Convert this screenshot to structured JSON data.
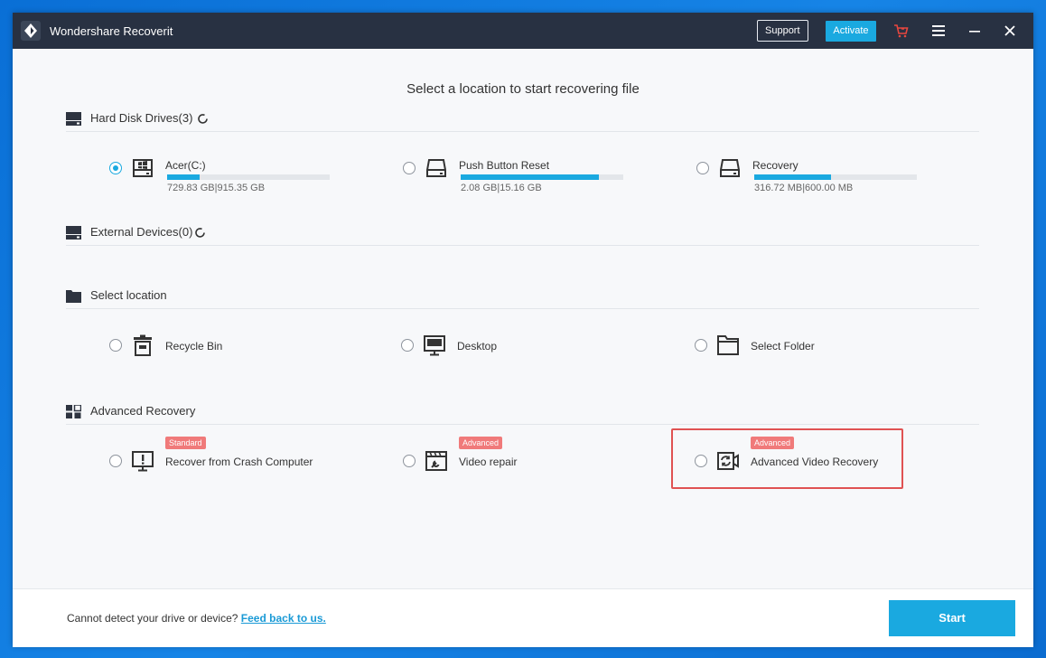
{
  "window": {
    "title": "Wondershare Recoverit",
    "support_label": "Support",
    "activate_label": "Activate"
  },
  "main": {
    "heading": "Select a location to start recovering file"
  },
  "sections": {
    "hard_disk": {
      "label": "Hard Disk Drives(3)",
      "drives": [
        {
          "name": "Acer(C:)",
          "size": "729.83 GB|915.35 GB",
          "used_fraction": 0.2,
          "selected": true
        },
        {
          "name": "Push Button Reset",
          "size": "2.08 GB|15.16 GB",
          "used_fraction": 0.85,
          "selected": false
        },
        {
          "name": "Recovery",
          "size": "316.72 MB|600.00 MB",
          "used_fraction": 0.47,
          "selected": false
        }
      ]
    },
    "external": {
      "label": "External Devices(0)"
    },
    "location": {
      "label": "Select location",
      "items": [
        {
          "name": "Recycle Bin"
        },
        {
          "name": "Desktop"
        },
        {
          "name": "Select Folder"
        }
      ]
    },
    "advanced": {
      "label": "Advanced Recovery",
      "items": [
        {
          "name": "Recover from Crash Computer",
          "tag": "Standard"
        },
        {
          "name": "Video repair",
          "tag": "Advanced"
        },
        {
          "name": "Advanced Video Recovery",
          "tag": "Advanced"
        }
      ]
    }
  },
  "footer": {
    "text": "Cannot detect your drive or device?",
    "link": "Feed back to us.",
    "start_label": "Start"
  },
  "colors": {
    "accent": "#1aa9e0",
    "titlebar": "#283142",
    "tag": "#f07a7a",
    "highlight": "#e05252",
    "cart": "#e8473f"
  }
}
